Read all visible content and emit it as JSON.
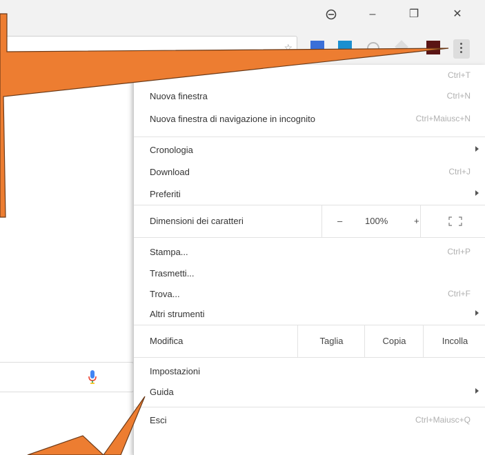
{
  "window": {
    "profile_icon": "profile-icon",
    "minimize_glyph": "–",
    "maximize_glyph": "❐",
    "close_glyph": "✕"
  },
  "menu": {
    "new_tab_shortcut": "Ctrl+T",
    "items_group1": [
      {
        "label": "Nuova finestra",
        "shortcut": "Ctrl+N"
      },
      {
        "label": "Nuova finestra di navigazione in incognito",
        "shortcut": "Ctrl+Maiusc+N"
      }
    ],
    "items_group2": [
      {
        "label": "Cronologia",
        "shortcut": ""
      },
      {
        "label": "Download",
        "shortcut": "Ctrl+J"
      },
      {
        "label": "Preferiti",
        "shortcut": ""
      }
    ],
    "zoom": {
      "label": "Dimensioni dei caratteri",
      "minus": "–",
      "value": "100%",
      "plus": "+"
    },
    "items_group3": [
      {
        "label": "Stampa...",
        "shortcut": "Ctrl+P"
      },
      {
        "label": "Trasmetti...",
        "shortcut": ""
      },
      {
        "label": "Trova...",
        "shortcut": "Ctrl+F"
      },
      {
        "label": "Altri strumenti",
        "shortcut": ""
      }
    ],
    "edit": {
      "label": "Modifica",
      "cut": "Taglia",
      "copy": "Copia",
      "paste": "Incolla"
    },
    "items_group4": [
      {
        "label": "Impostazioni",
        "shortcut": ""
      },
      {
        "label": "Guida",
        "shortcut": ""
      }
    ],
    "exit": {
      "label": "Esci",
      "shortcut": "Ctrl+Maiusc+Q"
    }
  },
  "colors": {
    "arrow_fill": "#ed7d31",
    "arrow_stroke": "#6b3a18"
  }
}
